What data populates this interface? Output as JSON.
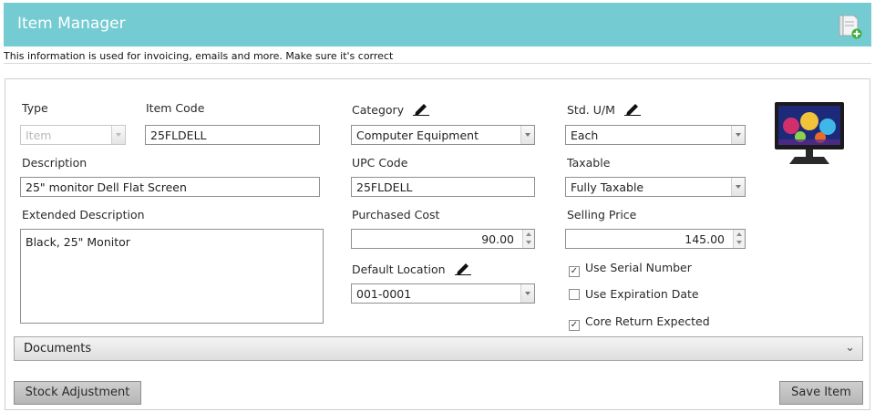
{
  "window": {
    "title": "Item Manager",
    "icon": "new-document-icon"
  },
  "subtitle": "This information is used for invoicing, emails and more. Make sure it's correct",
  "form": {
    "type": {
      "label": "Type",
      "value": "Item"
    },
    "item_code": {
      "label": "Item Code",
      "value": "25FLDELL"
    },
    "category": {
      "label": "Category",
      "value": "Computer Equipment"
    },
    "std_um": {
      "label": "Std. U/M",
      "value": "Each"
    },
    "description": {
      "label": "Description",
      "value": "25\" monitor Dell Flat Screen"
    },
    "upc_code": {
      "label": "UPC Code",
      "value": "25FLDELL"
    },
    "taxable": {
      "label": "Taxable",
      "value": "Fully Taxable"
    },
    "extended_description": {
      "label": "Extended Description",
      "value": "Black, 25\" Monitor"
    },
    "purchased_cost": {
      "label": "Purchased Cost",
      "value": "90.00"
    },
    "selling_price": {
      "label": "Selling Price",
      "value": "145.00"
    },
    "default_location": {
      "label": "Default Location",
      "value": "001-0001"
    },
    "checkboxes": [
      {
        "label": "Use Serial Number",
        "checked": true
      },
      {
        "label": "Use Expiration Date",
        "checked": false
      },
      {
        "label": "Core Return Expected",
        "checked": true
      }
    ],
    "image": "monitor-thumbnail"
  },
  "documents": {
    "label": "Documents"
  },
  "buttons": {
    "stock_adjustment": "Stock Adjustment",
    "save_item": "Save Item"
  },
  "colors": {
    "header": "#74cbd2",
    "button": "#c3c3c3"
  }
}
